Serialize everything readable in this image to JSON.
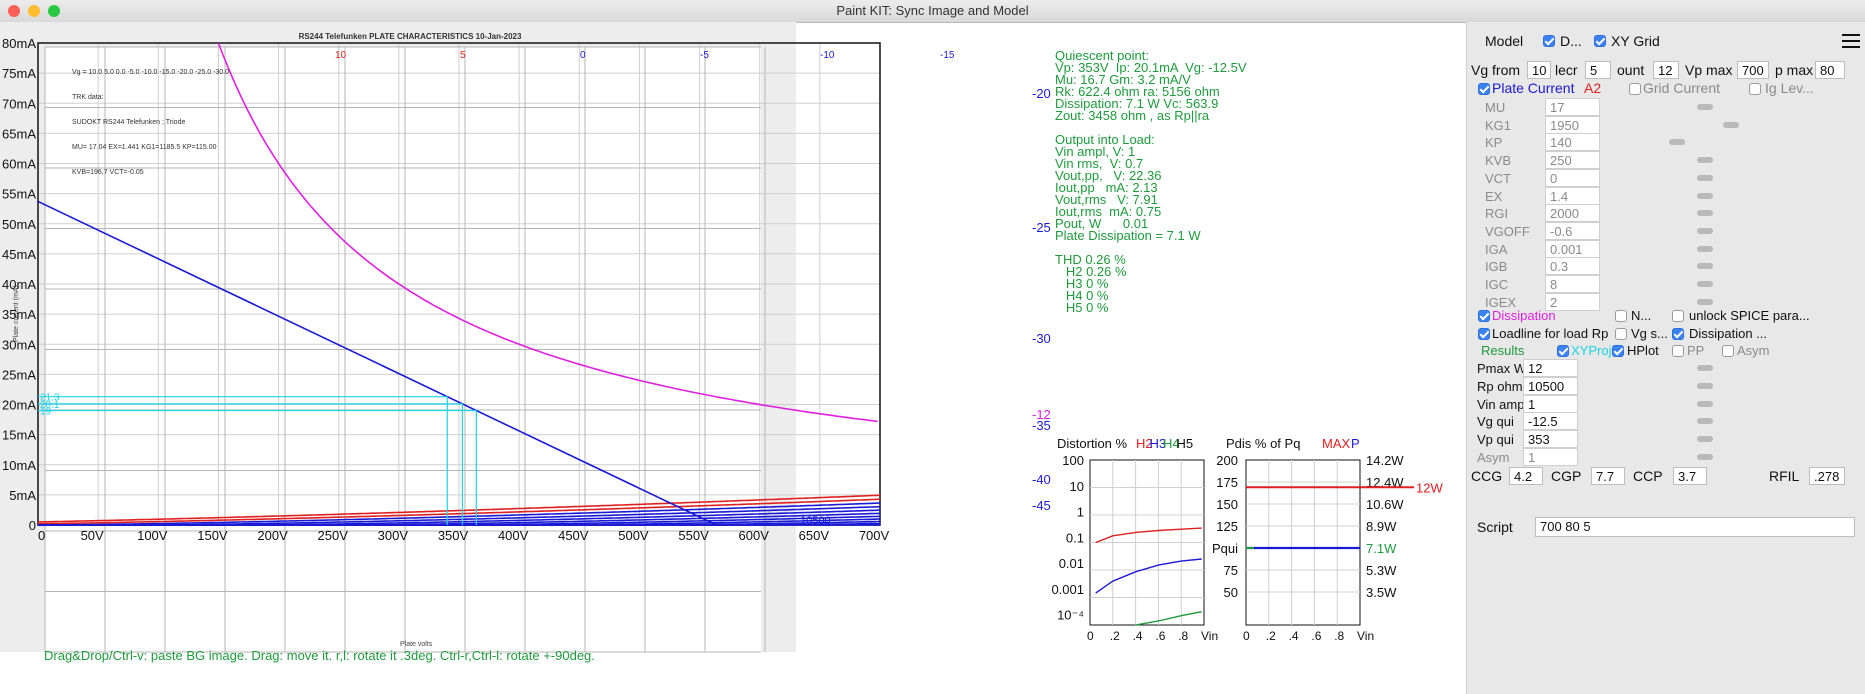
{
  "window": {
    "title": "Paint KIT: Sync Image and Model",
    "colors": {
      "close": "#fe5f57",
      "minimize": "#febc2e",
      "zoom": "#28c840"
    }
  },
  "plot": {
    "y_ticks": [
      "0",
      "5mA",
      "10mA",
      "15mA",
      "20mA",
      "25mA",
      "30mA",
      "35mA",
      "40mA",
      "45mA",
      "50mA",
      "55mA",
      "60mA",
      "65mA",
      "70mA",
      "75mA",
      "80mA"
    ],
    "x_ticks": [
      "0",
      "50V",
      "100V",
      "150V",
      "200V",
      "250V",
      "300V",
      "350V",
      "400V",
      "450V",
      "500V",
      "550V",
      "600V",
      "650V",
      "700V"
    ],
    "bg_image": {
      "title": "RS244 Telefunken PLATE CHARACTERISTICS  10-Jan-2023",
      "lines": [
        "Vg = 10.0  5.0  0.0 -5.0 -10.0 -15.0 -20.0 -25.0 -30.0",
        "TRK data:",
        "SUDOKT RS244 Telefunken ; Triode",
        "MU= 17.04 EX=1.441 KG1=1185.5 KP=115.00",
        "KVB=196.7 VCT=-0.05"
      ],
      "ylabel": "Plate current (mA)",
      "xlabel": "Plate volts",
      "top_labels": [
        "10",
        "5",
        "0",
        "-5",
        "-10",
        "-15"
      ],
      "bottom_label": "10500"
    },
    "curve_labels": [
      {
        "vg": "-20",
        "color": "#1a1ad6"
      },
      {
        "vg": "-25",
        "color": "#1a1ad6"
      },
      {
        "vg": "-30",
        "color": "#1a1ad6"
      },
      {
        "vg": "-35",
        "color": "#1a1ad6"
      },
      {
        "vg": "-40",
        "color": "#1a1ad6"
      },
      {
        "vg": "-45",
        "color": "#1a1ad6"
      },
      {
        "vg": "-12",
        "color": "#e020e0"
      }
    ],
    "left_marks": [
      "21.3",
      "20.1",
      "19"
    ],
    "colors": {
      "curve": "#1a1ad6",
      "positive": "#e02020",
      "dissipation": "#e020e0",
      "projection": "#19d4e6",
      "axis": "#111111",
      "grid": "#cfcfcf"
    }
  },
  "quiescent": [
    "Quiescent point:",
    "Vp: 353V  Ip: 20.1mA  Vg: -12.5V",
    "Mu: 16.7 Gm: 3.2 mA/V",
    "Rk: 622.4 ohm ra: 5156 ohm",
    "Dissipation: 7.1 W Vc: 563.9",
    "Zout: 3458 ohm , as Rp||ra",
    "",
    "Output into Load:",
    "Vin ampl, V: 1",
    "Vin rms,  V: 0.7",
    "Vout,pp,   V: 22.36",
    "Iout,pp   mA: 2.13",
    "Vout,rms   V: 7.91",
    "Iout,rms  mA: 0.75",
    "Pout, W      0.01",
    "Plate Dissipation = 7.1 W",
    "",
    "THD 0.26 %",
    "   H2 0.26 %",
    "   H3 0 %",
    "   H4 0 %",
    "   H5 0 %"
  ],
  "distortion": {
    "title": "Distortion %",
    "series": [
      "H2",
      "H3",
      "H4",
      "H5"
    ],
    "series_colors": [
      "#e02020",
      "#1a1ad6",
      "#1f9a3c",
      "#111111"
    ],
    "y_ticks": [
      "100",
      "10",
      "1",
      "0.1",
      "0.01",
      "0.001",
      "10⁻⁴"
    ],
    "x_ticks": [
      "0",
      ".2",
      ".4",
      ".6",
      ".8",
      "Vin"
    ]
  },
  "pdis": {
    "title": "Pdis % of Pq",
    "max_label": "MAX",
    "p_label": "P",
    "y_ticks": [
      "200",
      "175",
      "150",
      "125",
      "Pqui",
      "75",
      "50"
    ],
    "right_ticks": [
      "14.2W",
      "12.4W",
      "10.6W",
      "8.9W",
      "7.1W",
      "5.3W",
      "3.5W"
    ],
    "max_value": "12W",
    "x_ticks": [
      "0",
      ".2",
      ".4",
      ".6",
      ".8",
      "Vin"
    ]
  },
  "status": "Drag&Drop/Ctrl-v: paste BG image. Drag: move it. r,l: rotate it .3deg. Ctrl-r,Ctrl-l: rotate +-90deg.",
  "panel": {
    "model_label": "Model",
    "d_label": "D...",
    "xygrid_label": "XY Grid",
    "vg_from_label": "Vg from",
    "vg_from": "10",
    "decr_label": "lecr",
    "decr": "5",
    "count_label": "ount",
    "count": "12",
    "vp_max_label": "Vp max",
    "vp_max": "700",
    "ip_max_label": "p max",
    "ip_max": "80",
    "plate_current": "Plate Current",
    "a2": "A2",
    "grid_current": "Grid Current",
    "ig_lev": "Ig Lev...",
    "params": [
      {
        "name": "MU",
        "value": "17"
      },
      {
        "name": "KG1",
        "value": "1950"
      },
      {
        "name": "KP",
        "value": "140"
      },
      {
        "name": "KVB",
        "value": "250"
      },
      {
        "name": "VCT",
        "value": "0"
      },
      {
        "name": "EX",
        "value": "1.4"
      },
      {
        "name": "RGI",
        "value": "2000"
      },
      {
        "name": "VGOFF",
        "value": "-0.6"
      },
      {
        "name": "IGA",
        "value": "0.001"
      },
      {
        "name": "IGB",
        "value": "0.3"
      },
      {
        "name": "IGC",
        "value": "8"
      },
      {
        "name": "IGEX",
        "value": "2"
      }
    ],
    "dissipation": "Dissipation",
    "n_label": "N...",
    "unlock": "unlock SPICE para...",
    "loadline": "Loadline for load Rp",
    "vg_s": "Vg s...",
    "dissipation2": "Dissipation ...",
    "results": "Results",
    "xyproj": "XYProj",
    "hplot": "HPlot",
    "pp": "PP",
    "asym_cb": "Asym",
    "results_params": [
      {
        "name": "Pmax W",
        "value": "12"
      },
      {
        "name": "Rp ohm",
        "value": "10500"
      },
      {
        "name": "Vin ampl",
        "value": "1"
      },
      {
        "name": "Vg qui",
        "value": "-12.5"
      },
      {
        "name": "Vp qui",
        "value": "353"
      },
      {
        "name": "Asym",
        "value": "1"
      }
    ],
    "ccg_label": "CCG",
    "ccg": "4.2",
    "cgp_label": "CGP",
    "cgp": "7.7",
    "ccp_label": "CCP",
    "ccp": "3.7",
    "rfil_label": "RFIL",
    "rfil": ".278",
    "script_label": "Script",
    "script": "700 80 5"
  }
}
